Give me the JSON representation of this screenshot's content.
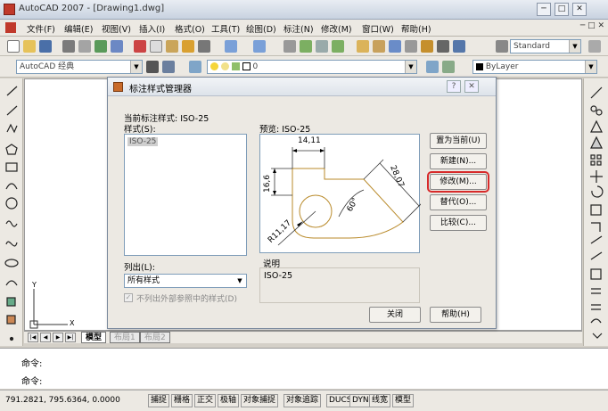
{
  "window": {
    "title": "AutoCAD 2007 - [Drawing1.dwg]",
    "controls": {
      "minimize": "─",
      "maximize": "□",
      "close": "✕"
    }
  },
  "menu": {
    "items": [
      "文件(F)",
      "编辑(E)",
      "视图(V)",
      "插入(I)",
      "格式(O)",
      "工具(T)",
      "绘图(D)",
      "标注(N)",
      "修改(M)",
      "窗口(W)",
      "帮助(H)"
    ],
    "doc_controls": "─ □ ✕"
  },
  "toolbar": {
    "text_style": "Standard",
    "workspace": "AutoCAD 经典",
    "layer": "0",
    "color": "ByLayer"
  },
  "dialog": {
    "title": "标注样式管理器",
    "current_style_label": "当前标注样式: ISO-25",
    "styles_label": "样式(S):",
    "styles": [
      "ISO-25"
    ],
    "preview_label": "预览: ISO-25",
    "list_label": "列出(L):",
    "list_value": "所有样式",
    "exclude_xref_label": "不列出外部参照中的样式(D)",
    "description_label": "说明",
    "description_value": "ISO-25",
    "buttons": {
      "set_current": "置为当前(U)",
      "new": "新建(N)...",
      "modify": "修改(M)...",
      "override": "替代(O)...",
      "compare": "比较(C)...",
      "close": "关闭",
      "help": "帮助(H)"
    },
    "preview_dims": {
      "width": "14,11",
      "height": "16,6",
      "diagonal": "28,07",
      "angle": "60°",
      "radius": "R11,17"
    }
  },
  "layout_tabs": [
    "模型",
    "布局1",
    "布局2"
  ],
  "ucs": {
    "x": "X",
    "y": "Y"
  },
  "command": {
    "line1": "命令:",
    "line2": "命令:"
  },
  "status": {
    "coords": "791.2821, 795.6364, 0.0000",
    "buttons": [
      "捕捉",
      "栅格",
      "正交",
      "极轴",
      "对象捕捉",
      "对象追踪",
      "DUCS",
      "DYN",
      "线宽",
      "模型"
    ]
  }
}
